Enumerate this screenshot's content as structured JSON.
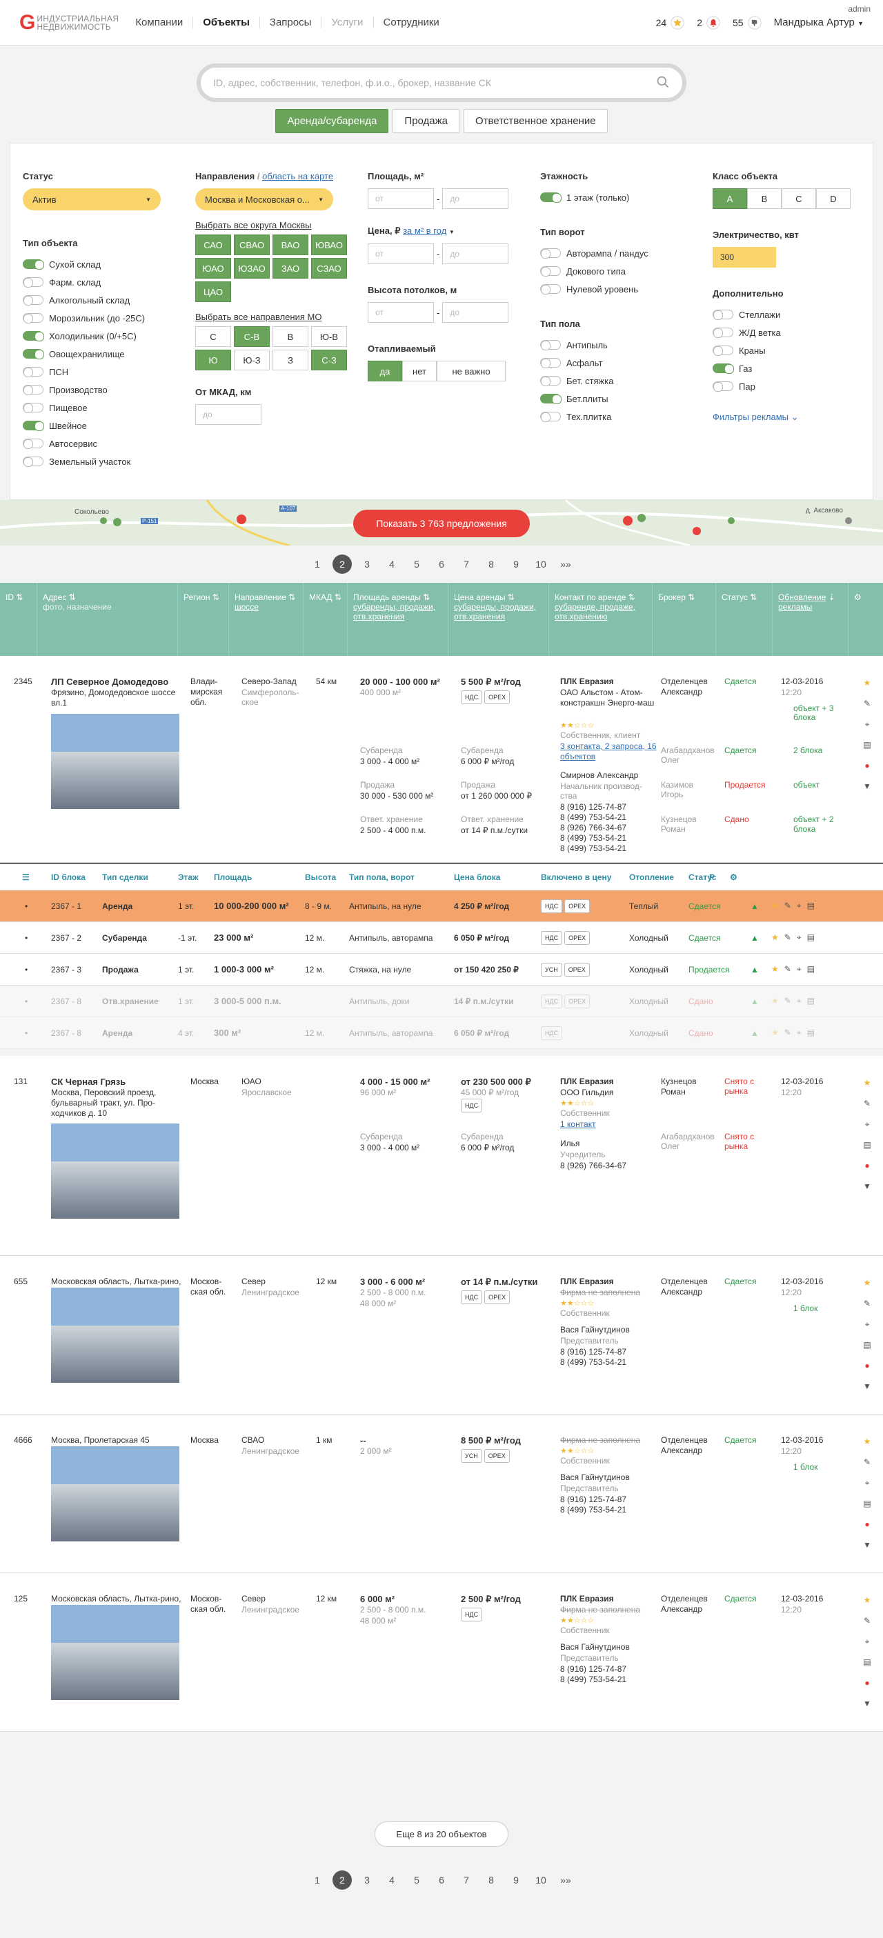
{
  "header": {
    "logo_letter": "G",
    "logo_line1": "ИНДУСТРИАЛЬНАЯ",
    "logo_line2": "НЕДВИЖИМОСТЬ",
    "nav": [
      "Компании",
      "Объекты",
      "Запросы",
      "Услуги",
      "Сотрудники"
    ],
    "favorites_count": "24",
    "alerts_count": "2",
    "dislikes_count": "55",
    "user": "Мандрыка Артур",
    "role": "admin"
  },
  "search": {
    "placeholder": "ID, адрес, собственник, телефон, ф.и.о., брокер, название СК"
  },
  "deal_tabs": [
    "Аренда/субаренда",
    "Продажа",
    "Ответственное хранение"
  ],
  "filters": {
    "status_title": "Статус",
    "status_value": "Актив",
    "type_title": "Тип объекта",
    "types": [
      {
        "label": "Сухой склад",
        "on": true
      },
      {
        "label": "Фарм. склад",
        "on": false
      },
      {
        "label": "Алкогольный склад",
        "on": false
      },
      {
        "label": "Морозильник (до -25С)",
        "on": false
      },
      {
        "label": "Холодильник (0/+5С)",
        "on": true
      },
      {
        "label": "Овощехранилище",
        "on": true
      },
      {
        "label": "ПСН",
        "on": false
      },
      {
        "label": "Производство",
        "on": false
      },
      {
        "label": "Пищевое",
        "on": false
      },
      {
        "label": "Швейное",
        "on": true
      },
      {
        "label": "Автосервис",
        "on": false
      },
      {
        "label": "Земельный участок",
        "on": false
      }
    ],
    "dir_title": "Направления",
    "dir_map_link": "область на карте",
    "dir_value": "Москва и Московская о...",
    "moscow_all": "Выбрать все округа Москвы",
    "moscow_districts": [
      {
        "label": "САО",
        "on": true
      },
      {
        "label": "СВАО",
        "on": true
      },
      {
        "label": "ВАО",
        "on": true
      },
      {
        "label": "ЮВАО",
        "on": true
      },
      {
        "label": "ЮАО",
        "on": true
      },
      {
        "label": "ЮЗАО",
        "on": true
      },
      {
        "label": "ЗАО",
        "on": true
      },
      {
        "label": "СЗАО",
        "on": true
      },
      {
        "label": "ЦАО",
        "on": true
      }
    ],
    "mo_all": "Выбрать все направления МО",
    "mo_dirs": [
      {
        "label": "С",
        "on": false
      },
      {
        "label": "С-В",
        "on": true
      },
      {
        "label": "В",
        "on": false
      },
      {
        "label": "Ю-В",
        "on": false
      },
      {
        "label": "Ю",
        "on": true
      },
      {
        "label": "Ю-З",
        "on": false
      },
      {
        "label": "З",
        "on": false
      },
      {
        "label": "С-З",
        "on": true
      }
    ],
    "mkad_title": "От МКАД, км",
    "mkad_ph": "до",
    "area_title": "Площадь, м²",
    "from_ph": "от",
    "to_ph": "до",
    "price_title": "Цена, ₽",
    "price_unit": "за м² в год",
    "height_title": "Высота потолков, м",
    "heated_title": "Отапливаемый",
    "heated_opts": [
      {
        "label": "да",
        "on": true
      },
      {
        "label": "нет",
        "on": false
      },
      {
        "label": "не важно",
        "on": false
      }
    ],
    "floors_title": "Этажность",
    "floors": [
      {
        "label": "1 этаж (только)",
        "on": true
      }
    ],
    "gates_title": "Тип ворот",
    "gates": [
      {
        "label": "Авторампа / пандус",
        "on": false
      },
      {
        "label": "Докового типа",
        "on": false
      },
      {
        "label": "Нулевой уровень",
        "on": false
      }
    ],
    "floor_title": "Тип пола",
    "floor_types": [
      {
        "label": "Антипыль",
        "on": false
      },
      {
        "label": "Асфальт",
        "on": false
      },
      {
        "label": "Бет. стяжка",
        "on": false
      },
      {
        "label": "Бет.плиты",
        "on": true
      },
      {
        "label": "Тех.плитка",
        "on": false
      }
    ],
    "class_title": "Класс объекта",
    "classes": [
      {
        "label": "A",
        "on": true
      },
      {
        "label": "B",
        "on": false
      },
      {
        "label": "C",
        "on": false
      },
      {
        "label": "D",
        "on": false
      }
    ],
    "power_title": "Электричество, квт",
    "power_value": "300",
    "extra_title": "Дополнительно",
    "extras": [
      {
        "label": "Стеллажи",
        "on": false
      },
      {
        "label": "Ж/Д ветка",
        "on": false
      },
      {
        "label": "Краны",
        "on": false
      },
      {
        "label": "Газ",
        "on": true
      },
      {
        "label": "Пар",
        "on": false
      }
    ],
    "ads_filters": "Фильтры рекламы"
  },
  "map": {
    "show_button": "Показать 3 763 предложения",
    "labels": [
      "Сокольево",
      "д. Аксаково"
    ],
    "road_labels": [
      "Р-151",
      "А-107"
    ]
  },
  "pagination": {
    "pages": [
      "1",
      "2",
      "3",
      "4",
      "5",
      "6",
      "7",
      "8",
      "9",
      "10",
      "»»"
    ],
    "current": "2"
  },
  "table_head": {
    "id": "ID",
    "address": "Адрес",
    "address_sub": "фото, назначение",
    "region": "Регион",
    "direction": "Направление",
    "direction_sub": "шоссе",
    "mkad": "МКАД",
    "area": "Площадь аренды",
    "area_sub": "субаренды, продажи, отв.хранения",
    "price": "Цена аренды",
    "price_sub": "субаренды, продажи, отв.хранения",
    "contact": "Контакт по аренде",
    "contact_sub": "субаренде, продаже, отв.хранению",
    "broker": "Брокер",
    "status": "Статус",
    "updated": "Обновление",
    "updated_sub": "рекламы"
  },
  "rows": [
    {
      "id": "2345",
      "title": "ЛП Северное Домодедово",
      "address": "Фрязино, Домодедовское шоссе вл.1",
      "region": "Влади-мирская обл.",
      "dir": "Северо-Запад",
      "dir_sub": "Симферополь-ское",
      "mkad": "54 км",
      "area": "20 000 - 100 000 м²",
      "area_sub": "400 000 м²",
      "price": "5 500 ₽ м²/год",
      "tags": [
        "НДС",
        "OPEX"
      ],
      "contact_company": "ПЛК Евразия",
      "contact_person_co": "ОАО Альстом - Атом-констракшн  Энерго-маш",
      "contact_role": "Собственник, клиент",
      "contact_links": "3 контакта, 2 запроса, 16 объектов",
      "contact2": "Смирнов Александр",
      "contact2_role": "Начальник производ-ства",
      "phones": [
        "8 (916) 125-74-87",
        "8 (499) 753-54-21",
        "8 (926) 766-34-67",
        "8 (499) 753-54-21",
        "8 (499) 753-54-21"
      ],
      "broker": "Отделенцев Александр",
      "status": "Сдается",
      "date": "12-03-2016",
      "time": "12:20",
      "blocks": "объект + 3 блока",
      "sub": [
        {
          "label": "Субаренда",
          "area": "3 000 - 4 000 м²",
          "price_label": "Субаренда",
          "price": "6 000 ₽ м²/год",
          "broker": "Агабардханов Олег",
          "status": "Сдается",
          "blocks": "2 блока"
        },
        {
          "label": "Продажа",
          "area": "30 000 - 530 000 м²",
          "price_label": "Продажа",
          "price": "от 1 260 000 000 ₽",
          "broker": "Казимов Игорь",
          "status": "Продается",
          "blocks": "объект"
        },
        {
          "label": "Ответ. хранение",
          "area": "2 500 - 4 000 п.м.",
          "price_label": "Ответ. хранение",
          "price": "от 14 ₽ п.м./сутки",
          "broker": "Кузнецов Роман",
          "status": "Сдано",
          "blocks": "объект + 2 блока"
        }
      ]
    },
    {
      "id": "131",
      "title": "СК Черная Грязь",
      "address": "Москва, Перовский проезд, бульварный тракт, ул. Про-ходчиков д. 10",
      "region": "Москва",
      "dir": "ЮАО",
      "dir_sub": "Ярославское",
      "mkad": "",
      "area": "4 000 - 15 000 м²",
      "area_sub": "96 000 м²",
      "price": "от 230 500 000 ₽",
      "price_sub": "45 000 ₽ м²/год",
      "tags": [
        "НДС"
      ],
      "contact_company": "ПЛК Евразия",
      "contact_person_co": "ООО Гильдия",
      "contact_role": "Собственник",
      "contact_links": "1 контакт",
      "contact2": "Илья",
      "contact2_role": "Учредитель",
      "phones": [
        "8 (926) 766-34-67"
      ],
      "broker": "Кузнецов Роман",
      "status": "Снято с рынка",
      "date": "12-03-2016",
      "time": "12:20",
      "sub": [
        {
          "label": "Субаренда",
          "area": "3 000 - 4 000 м²",
          "price_label": "Субаренда",
          "price": "6 000 ₽ м²/год",
          "broker": "Агабардханов Олег",
          "status": "Снято с рынка"
        }
      ]
    },
    {
      "id": "655",
      "title": "",
      "address": "Московская область, Лытка-рино, СПЗ-2",
      "region": "Москов-ская обл.",
      "dir": "Север",
      "dir_sub": "Ленинградское",
      "mkad": "12 км",
      "area": "3 000 - 6 000 м²",
      "area_sub": "2 500 - 8 000 п.м.",
      "area_sub2": "48 000 м²",
      "price": "от 14 ₽ п.м./сутки",
      "tags": [
        "НДС",
        "OPEX"
      ],
      "contact_company": "ПЛК Евразия",
      "contact_person_co": "Фирма не заполнена",
      "contact_role": "Собственник",
      "contact2": "Вася Гайнутдинов",
      "contact2_role": "Представитель",
      "phones": [
        "8 (916) 125-74-87",
        "8 (499) 753-54-21"
      ],
      "broker": "Отделенцев Александр",
      "status": "Сдается",
      "date": "12-03-2016",
      "time": "12:20",
      "blocks": "1 блок"
    },
    {
      "id": "4666",
      "title": "",
      "address": "Москва, Пролетарская 45",
      "region": "Москва",
      "dir": "СВАО",
      "dir_sub": "Ленинградское",
      "mkad": "1 км",
      "area": "--",
      "area_sub": "2 000 м²",
      "price": "8 500 ₽ м²/год",
      "tags": [
        "УСН",
        "OPEX"
      ],
      "contact_company": "",
      "contact_person_co": "Фирма не заполнена",
      "contact_role": "Собственник",
      "contact2": "Вася Гайнутдинов",
      "contact2_role": "Представитель",
      "phones": [
        "8 (916) 125-74-87",
        "8 (499) 753-54-21"
      ],
      "broker": "Отделенцев Александр",
      "status": "Сдается",
      "date": "12-03-2016",
      "time": "12:20",
      "blocks": "1 блок"
    },
    {
      "id": "125",
      "title": "",
      "address": "Московская область, Лытка-рино, СПЗ-2",
      "region": "Москов-ская обл.",
      "dir": "Север",
      "dir_sub": "Ленинградское",
      "mkad": "12 км",
      "area": "6 000 м²",
      "area_sub": "2 500 - 8 000 п.м.",
      "area_sub2": "48 000 м²",
      "price": "2 500 ₽ м²/год",
      "tags": [
        "НДС"
      ],
      "contact_company": "ПЛК Евразия",
      "contact_person_co": "Фирма не заполнена",
      "contact_role": "Собственник",
      "contact2": "Вася Гайнутдинов",
      "contact2_role": "Представитель",
      "phones": [
        "8 (916) 125-74-87",
        "8 (499) 753-54-21"
      ],
      "broker": "Отделенцев Александр",
      "status": "Сдается",
      "date": "12-03-2016",
      "time": "12:20"
    }
  ],
  "blocks_head": [
    "ID блока",
    "Тип сделки",
    "Этаж",
    "Площадь",
    "Высота",
    "Тип пола, ворот",
    "Цена блока",
    "Включено в цену",
    "Отопление",
    "Статус",
    "Р"
  ],
  "blocks": [
    {
      "id": "2367 - 1",
      "deal": "Аренда",
      "floor": "1 эт.",
      "area": "10 000-200 000 м²",
      "height": "8 - 9 м.",
      "floor_type": "Антипыль, на нуле",
      "price": "4 250 ₽ м²/год",
      "tags": [
        "НДС",
        "OPEX"
      ],
      "heat": "Теплый",
      "status": "Сдается"
    },
    {
      "id": "2367 - 2",
      "deal": "Субаренда",
      "floor": "-1 эт.",
      "area": "23 000 м²",
      "height": "12 м.",
      "floor_type": "Антипыль, авторампа",
      "price": "6 050 ₽ м²/год",
      "tags": [
        "НДС",
        "OPEX"
      ],
      "heat": "Холодный",
      "status": "Сдается"
    },
    {
      "id": "2367 - 3",
      "deal": "Продажа",
      "floor": "1 эт.",
      "area": "1 000-3 000 м²",
      "height": "12 м.",
      "floor_type": "Стяжка, на нуле",
      "price": "от 150 420 250 ₽",
      "tags": [
        "УСН",
        "OPEX"
      ],
      "heat": "Холодный",
      "status": "Продается"
    },
    {
      "id": "2367 - 8",
      "deal": "Отв.хранение",
      "floor": "1 эт.",
      "area": "3 000-5 000 п.м.",
      "height": "",
      "floor_type": "Антипыль, доки",
      "price": "14 ₽ п.м./сутки",
      "tags": [
        "НДС",
        "OPEX"
      ],
      "heat": "Холодный",
      "status": "Сдано"
    },
    {
      "id": "2367 - 8",
      "deal": "Аренда",
      "floor": "4 эт.",
      "area": "300 м²",
      "height": "12 м.",
      "floor_type": "Антипыль, авторампа",
      "price": "6 050 ₽ м²/год",
      "tags": [
        "НДС"
      ],
      "heat": "Холодный",
      "status": "Сдано"
    }
  ],
  "more": {
    "text": "Еще 8 из 20 объектов"
  }
}
